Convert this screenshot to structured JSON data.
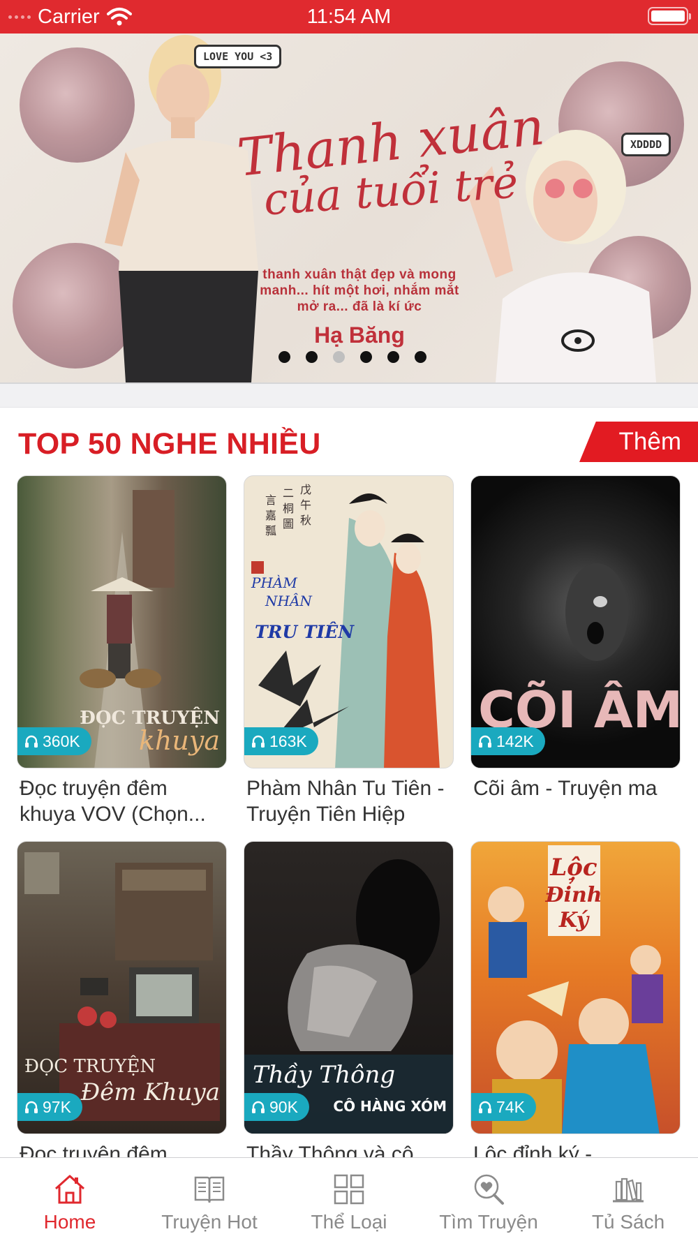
{
  "status_bar": {
    "carrier": "Carrier",
    "time": "11:54 AM"
  },
  "banner": {
    "title_line1": "Thanh xuân",
    "title_line2": "của tuổi trẻ",
    "subtitle": "thanh xuân thật đẹp và mong manh... hít một hơi, nhắm mắt mở ra... đã là kí ức",
    "author": "Hạ Băng",
    "bubble_left": "LOVE YOU <3",
    "bubble_right": "XDDDD",
    "page_count": 6,
    "active_page": 3
  },
  "section": {
    "title": "TOP 50 NGHE NHIỀU",
    "more_label": "Thêm"
  },
  "cards": [
    {
      "listens": "360K",
      "title": "Đọc truyện đêm khuya VOV (Chọn...",
      "cover_text": "ĐỌC TRUYỆN khuya"
    },
    {
      "listens": "163K",
      "title": "Phàm Nhân Tu Tiên - Truyện Tiên Hiệp",
      "cover_text": "PHÀM NHÂN TRU TIÊN"
    },
    {
      "listens": "142K",
      "title": "Cõi âm - Truyện ma",
      "cover_text": "CÕI ÂM"
    },
    {
      "listens": "97K",
      "title": "Đọc truyện đêm",
      "cover_text": "ĐỌC TRUYỆN Đêm Khuya"
    },
    {
      "listens": "90K",
      "title": "Thầy Thông và cô",
      "cover_text": "Thầy Thông CÔ HÀNG XÓM"
    },
    {
      "listens": "74K",
      "title": "Lộc đỉnh ký -",
      "cover_text": "Lộc Đỉnh Ký"
    }
  ],
  "tabs": [
    {
      "label": "Home",
      "icon": "home-icon",
      "active": true
    },
    {
      "label": "Truyện Hot",
      "icon": "book-icon",
      "active": false
    },
    {
      "label": "Thể Loại",
      "icon": "grid-icon",
      "active": false
    },
    {
      "label": "Tìm Truyện",
      "icon": "search-heart-icon",
      "active": false
    },
    {
      "label": "Tủ Sách",
      "icon": "bookshelf-icon",
      "active": false
    }
  ],
  "colors": {
    "brand_red": "#e02a2f",
    "badge_teal": "#1aa9bf",
    "inactive_gray": "#8a8a8a"
  }
}
